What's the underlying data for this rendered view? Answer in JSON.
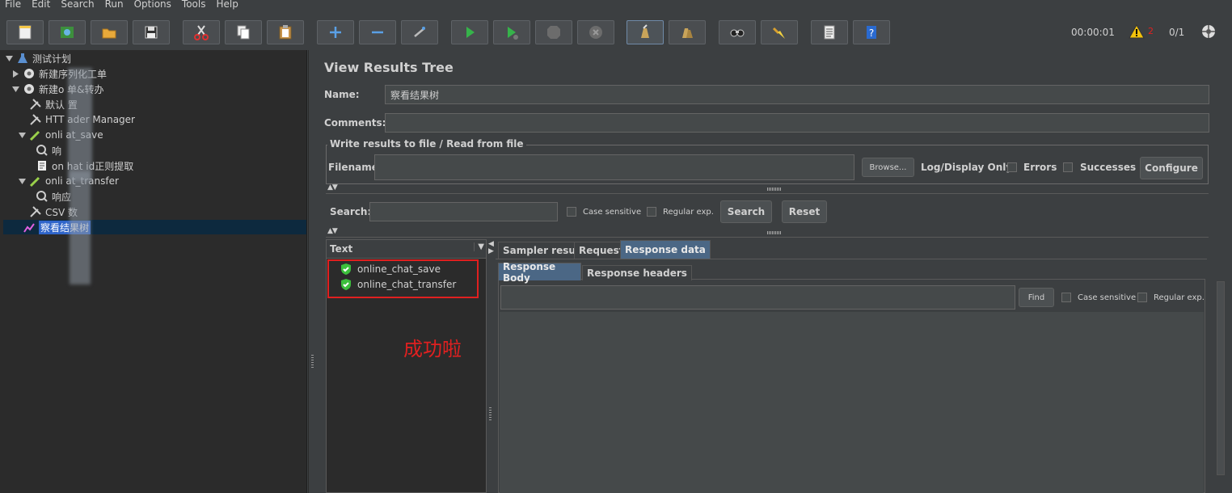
{
  "menu": [
    "File",
    "Edit",
    "Search",
    "Run",
    "Options",
    "Tools",
    "Help"
  ],
  "toolbar": {
    "buttons": [
      "new-icon",
      "templates-icon",
      "open-icon",
      "save-icon",
      "cut-icon",
      "copy-icon",
      "paste-icon",
      "expand-icon",
      "collapse-icon",
      "toggle-icon",
      "start-icon",
      "start-no-pause-icon",
      "stop-icon",
      "shutdown-icon",
      "clear-icon",
      "clear-all-icon",
      "search-icon",
      "reset-search-icon",
      "function-helper-icon",
      "help-icon"
    ],
    "elapsed": "00:00:01",
    "warning_count": "2",
    "threads": "0/1"
  },
  "tree": {
    "items": [
      {
        "label": "测试计划",
        "icon": "test-plan-icon"
      },
      {
        "label": "新建序列化工单",
        "icon": "thread-group-icon"
      },
      {
        "label": "新建o   单&转办",
        "icon": "thread-group-icon"
      },
      {
        "label": "默认     置",
        "icon": "config-icon"
      },
      {
        "label": "HTT     ader Manager",
        "icon": "config-icon"
      },
      {
        "label": "onli     at_save",
        "icon": "sampler-icon"
      },
      {
        "label": "响     ",
        "icon": "assertion-icon"
      },
      {
        "label": "on     hat id正则提取",
        "icon": "extractor-icon"
      },
      {
        "label": "onli     at_transfer",
        "icon": "sampler-icon"
      },
      {
        "label": "响应",
        "icon": "assertion-icon"
      },
      {
        "label": "CSV 数",
        "icon": "config-icon"
      },
      {
        "label": "察看结果树",
        "icon": "listener-icon"
      }
    ]
  },
  "panel": {
    "title": "View Results Tree",
    "name_label": "Name:",
    "name_value": "察看结果树",
    "comments_label": "Comments:",
    "comments_value": "",
    "file_group_title": "Write results to file / Read from file",
    "filename_label": "Filename",
    "filename_value": "",
    "browse_label": "Browse...",
    "log_display_label": "Log/Display Only:",
    "errors_label": "Errors",
    "successes_label": "Successes",
    "configure_label": "Configure",
    "search_label": "Search:",
    "search_value": "",
    "case_sensitive_label": "Case sensitive",
    "regular_exp_label": "Regular exp.",
    "search_button": "Search",
    "reset_button": "Reset"
  },
  "results": {
    "header": "Text",
    "items": [
      "online_chat_save",
      "online_chat_transfer"
    ],
    "annotation": "成功啦"
  },
  "tabs": {
    "top": [
      "Sampler result",
      "Request",
      "Response data"
    ],
    "active_top": "Response data",
    "sub": [
      "Response Body",
      "Response headers"
    ],
    "active_sub": "Response Body"
  },
  "response": {
    "find_value": "",
    "find_button": "Find",
    "case_sensitive_label": "Case sensitive",
    "regular_exp_label": "Regular exp."
  },
  "colors": {
    "background": "#3c3f41",
    "tree_bg": "#2b2b2b",
    "selection": "#2f65ca",
    "active_tab": "#4b6785",
    "annotation": "#e02020",
    "success_icon": "#3cbf3c"
  }
}
